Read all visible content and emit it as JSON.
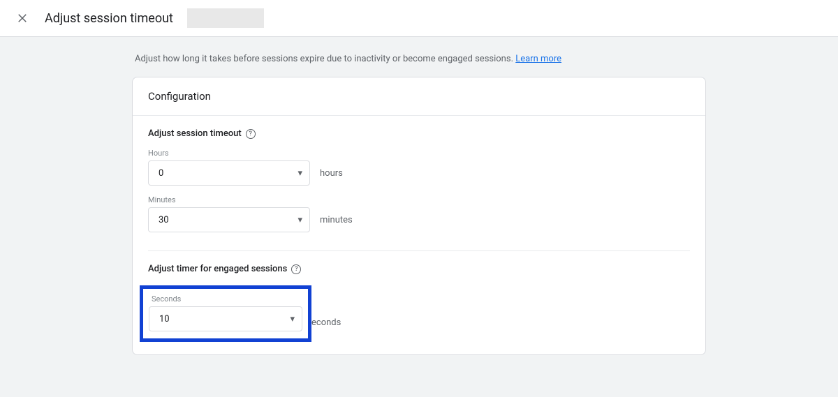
{
  "header": {
    "title": "Adjust session timeout"
  },
  "description": {
    "text": "Adjust how long it takes before sessions expire due to inactivity or become engaged sessions. ",
    "link_text": "Learn more"
  },
  "card": {
    "title": "Configuration",
    "session_timeout": {
      "title": "Adjust session timeout",
      "hours": {
        "label": "Hours",
        "value": "0",
        "unit": "hours"
      },
      "minutes": {
        "label": "Minutes",
        "value": "30",
        "unit": "minutes"
      }
    },
    "engaged_sessions": {
      "title": "Adjust timer for engaged sessions",
      "seconds": {
        "label": "Seconds",
        "value": "10",
        "unit": "econds"
      }
    }
  }
}
